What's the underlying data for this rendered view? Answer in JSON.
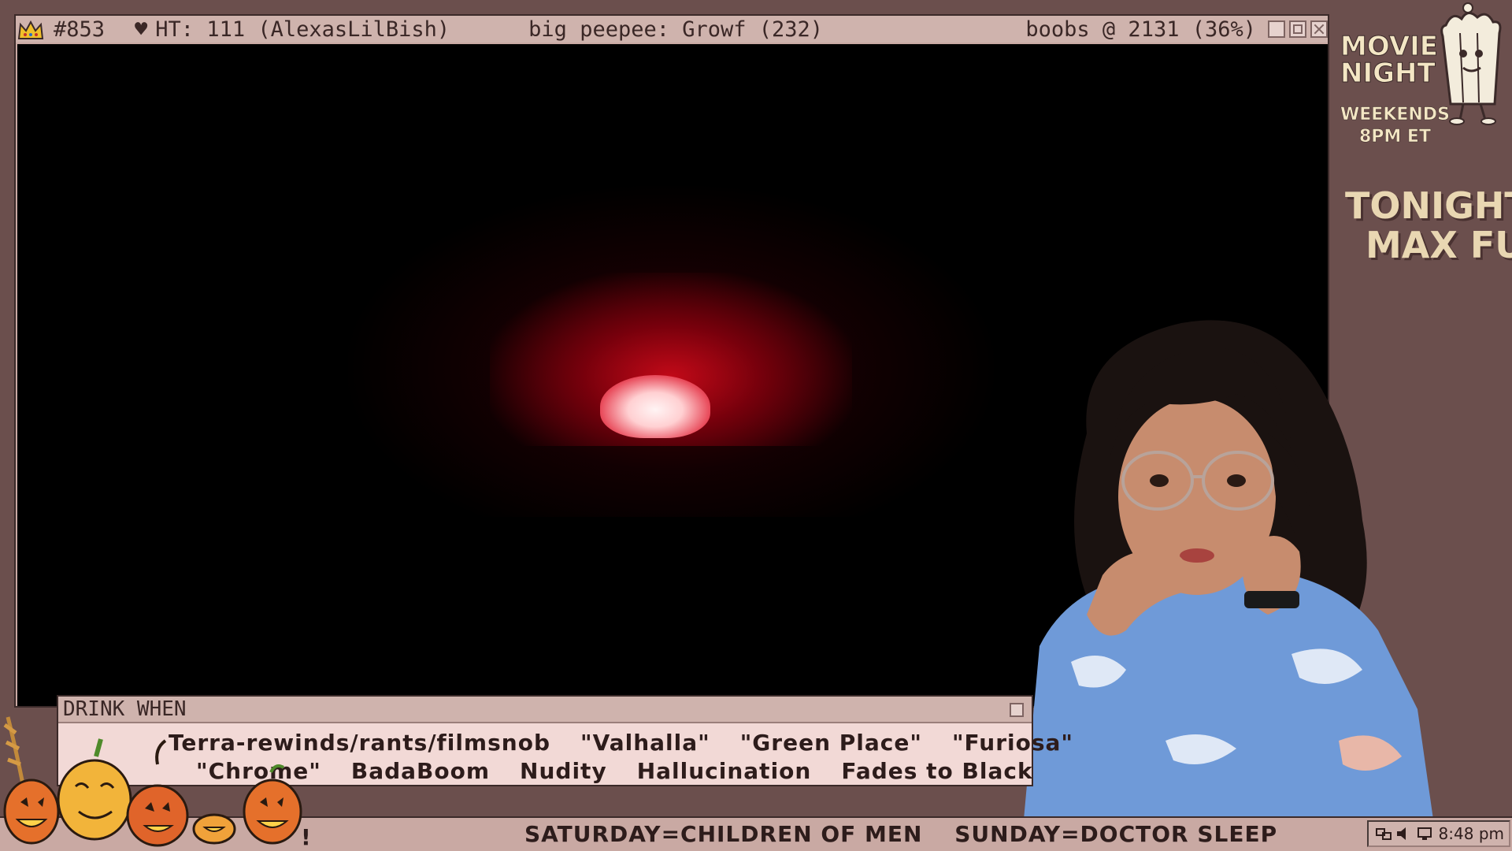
{
  "titlebar": {
    "rank": "#853",
    "heart": "♥",
    "hype_train": "HT: 111 (AlexasLilBish)",
    "middle": "big peepee: Growf (232)",
    "right": "boobs @ 2131 (36%)"
  },
  "drink_panel": {
    "title": "DRINK WHEN",
    "row1": [
      "Terra-rewinds/rants/filmsnob",
      "\"Valhalla\"",
      "\"Green Place\"",
      "\"Furiosa\""
    ],
    "row2": [
      "\"Chrome\"",
      "BadaBoom",
      "Nudity",
      "Hallucination",
      "Fades to Black"
    ]
  },
  "ticker": {
    "saturday": "SATURDAY=CHILDREN OF MEN",
    "sunday": "SUNDAY=DOCTOR SLEEP",
    "leading": "!"
  },
  "tray": {
    "time": "8:48 pm"
  },
  "sidebar": {
    "movie_night_line1": "MOVIE",
    "movie_night_line2": "NIGHT",
    "weekends": "WEEKENDS",
    "time": "8PM ET",
    "tonight_label": "TONIGHT:",
    "tonight_movie": "MAX FUR"
  },
  "colors": {
    "frame_bg": "#6b4f4d",
    "window": "#c9a9a3",
    "panel": "#f2d9d6",
    "glow": "#d0081c"
  }
}
